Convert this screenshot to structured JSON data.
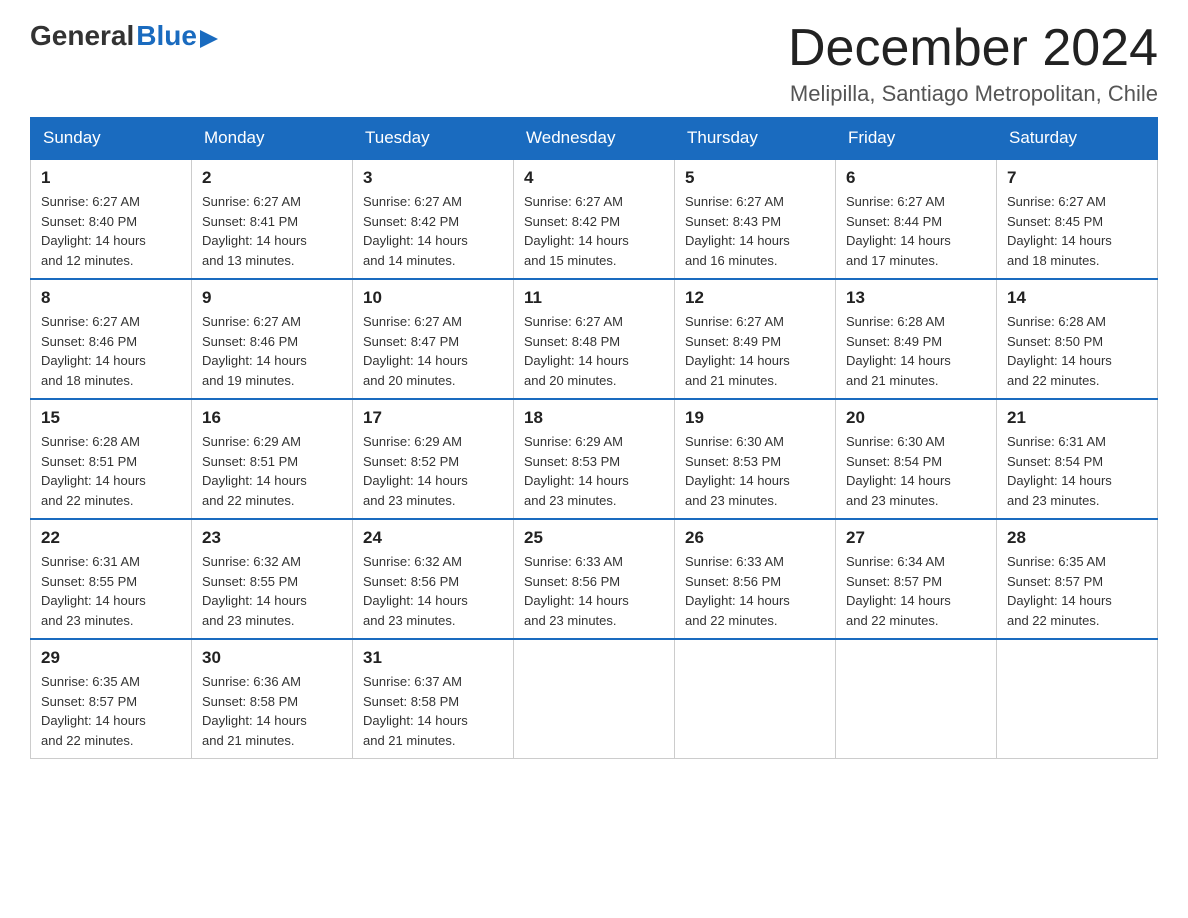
{
  "logo": {
    "general": "General",
    "blue": "Blue",
    "arrow": "▶"
  },
  "header": {
    "month_year": "December 2024",
    "location": "Melipilla, Santiago Metropolitan, Chile"
  },
  "days_of_week": [
    "Sunday",
    "Monday",
    "Tuesday",
    "Wednesday",
    "Thursday",
    "Friday",
    "Saturday"
  ],
  "weeks": [
    [
      {
        "day": "1",
        "sunrise": "6:27 AM",
        "sunset": "8:40 PM",
        "daylight": "14 hours and 12 minutes."
      },
      {
        "day": "2",
        "sunrise": "6:27 AM",
        "sunset": "8:41 PM",
        "daylight": "14 hours and 13 minutes."
      },
      {
        "day": "3",
        "sunrise": "6:27 AM",
        "sunset": "8:42 PM",
        "daylight": "14 hours and 14 minutes."
      },
      {
        "day": "4",
        "sunrise": "6:27 AM",
        "sunset": "8:42 PM",
        "daylight": "14 hours and 15 minutes."
      },
      {
        "day": "5",
        "sunrise": "6:27 AM",
        "sunset": "8:43 PM",
        "daylight": "14 hours and 16 minutes."
      },
      {
        "day": "6",
        "sunrise": "6:27 AM",
        "sunset": "8:44 PM",
        "daylight": "14 hours and 17 minutes."
      },
      {
        "day": "7",
        "sunrise": "6:27 AM",
        "sunset": "8:45 PM",
        "daylight": "14 hours and 18 minutes."
      }
    ],
    [
      {
        "day": "8",
        "sunrise": "6:27 AM",
        "sunset": "8:46 PM",
        "daylight": "14 hours and 18 minutes."
      },
      {
        "day": "9",
        "sunrise": "6:27 AM",
        "sunset": "8:46 PM",
        "daylight": "14 hours and 19 minutes."
      },
      {
        "day": "10",
        "sunrise": "6:27 AM",
        "sunset": "8:47 PM",
        "daylight": "14 hours and 20 minutes."
      },
      {
        "day": "11",
        "sunrise": "6:27 AM",
        "sunset": "8:48 PM",
        "daylight": "14 hours and 20 minutes."
      },
      {
        "day": "12",
        "sunrise": "6:27 AM",
        "sunset": "8:49 PM",
        "daylight": "14 hours and 21 minutes."
      },
      {
        "day": "13",
        "sunrise": "6:28 AM",
        "sunset": "8:49 PM",
        "daylight": "14 hours and 21 minutes."
      },
      {
        "day": "14",
        "sunrise": "6:28 AM",
        "sunset": "8:50 PM",
        "daylight": "14 hours and 22 minutes."
      }
    ],
    [
      {
        "day": "15",
        "sunrise": "6:28 AM",
        "sunset": "8:51 PM",
        "daylight": "14 hours and 22 minutes."
      },
      {
        "day": "16",
        "sunrise": "6:29 AM",
        "sunset": "8:51 PM",
        "daylight": "14 hours and 22 minutes."
      },
      {
        "day": "17",
        "sunrise": "6:29 AM",
        "sunset": "8:52 PM",
        "daylight": "14 hours and 23 minutes."
      },
      {
        "day": "18",
        "sunrise": "6:29 AM",
        "sunset": "8:53 PM",
        "daylight": "14 hours and 23 minutes."
      },
      {
        "day": "19",
        "sunrise": "6:30 AM",
        "sunset": "8:53 PM",
        "daylight": "14 hours and 23 minutes."
      },
      {
        "day": "20",
        "sunrise": "6:30 AM",
        "sunset": "8:54 PM",
        "daylight": "14 hours and 23 minutes."
      },
      {
        "day": "21",
        "sunrise": "6:31 AM",
        "sunset": "8:54 PM",
        "daylight": "14 hours and 23 minutes."
      }
    ],
    [
      {
        "day": "22",
        "sunrise": "6:31 AM",
        "sunset": "8:55 PM",
        "daylight": "14 hours and 23 minutes."
      },
      {
        "day": "23",
        "sunrise": "6:32 AM",
        "sunset": "8:55 PM",
        "daylight": "14 hours and 23 minutes."
      },
      {
        "day": "24",
        "sunrise": "6:32 AM",
        "sunset": "8:56 PM",
        "daylight": "14 hours and 23 minutes."
      },
      {
        "day": "25",
        "sunrise": "6:33 AM",
        "sunset": "8:56 PM",
        "daylight": "14 hours and 23 minutes."
      },
      {
        "day": "26",
        "sunrise": "6:33 AM",
        "sunset": "8:56 PM",
        "daylight": "14 hours and 22 minutes."
      },
      {
        "day": "27",
        "sunrise": "6:34 AM",
        "sunset": "8:57 PM",
        "daylight": "14 hours and 22 minutes."
      },
      {
        "day": "28",
        "sunrise": "6:35 AM",
        "sunset": "8:57 PM",
        "daylight": "14 hours and 22 minutes."
      }
    ],
    [
      {
        "day": "29",
        "sunrise": "6:35 AM",
        "sunset": "8:57 PM",
        "daylight": "14 hours and 22 minutes."
      },
      {
        "day": "30",
        "sunrise": "6:36 AM",
        "sunset": "8:58 PM",
        "daylight": "14 hours and 21 minutes."
      },
      {
        "day": "31",
        "sunrise": "6:37 AM",
        "sunset": "8:58 PM",
        "daylight": "14 hours and 21 minutes."
      },
      null,
      null,
      null,
      null
    ]
  ],
  "labels": {
    "sunrise": "Sunrise:",
    "sunset": "Sunset:",
    "daylight": "Daylight:"
  }
}
